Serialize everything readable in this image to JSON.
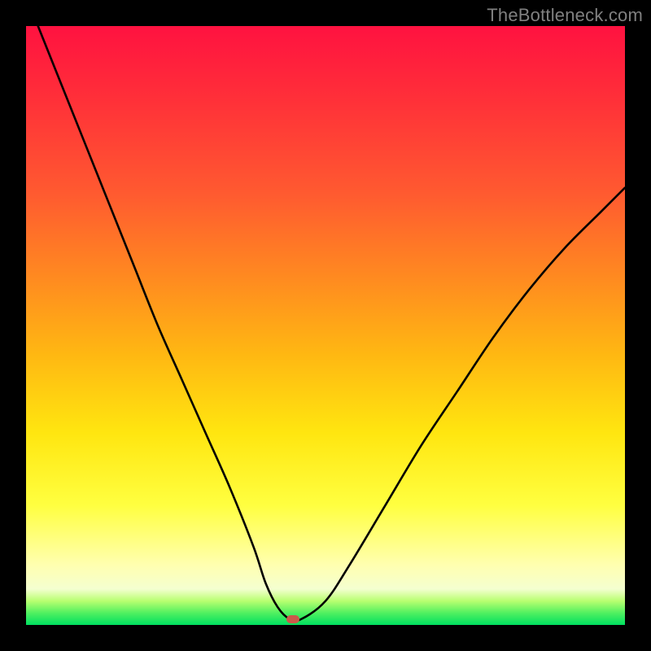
{
  "watermark": "TheBottleneck.com",
  "colors": {
    "frame": "#000000",
    "gradient_top": "#ff1240",
    "gradient_mid1": "#ff8a20",
    "gradient_mid2": "#ffe610",
    "gradient_bottom": "#00e060",
    "curve": "#000000",
    "marker": "#cc5a4a",
    "watermark_text": "#808080"
  },
  "chart_data": {
    "type": "line",
    "title": "",
    "xlabel": "",
    "ylabel": "",
    "xlim": [
      0,
      100
    ],
    "ylim": [
      0,
      100
    ],
    "x": [
      2,
      6,
      10,
      14,
      18,
      22,
      26,
      30,
      34,
      38,
      40,
      42,
      44,
      46,
      50,
      54,
      60,
      66,
      72,
      78,
      84,
      90,
      96,
      100
    ],
    "values": [
      100,
      90,
      80,
      70,
      60,
      50,
      41,
      32,
      23,
      13,
      7,
      3,
      1,
      1,
      4,
      10,
      20,
      30,
      39,
      48,
      56,
      63,
      69,
      73
    ],
    "marker": {
      "x_pct": 44.5,
      "y_pct": 1.0
    },
    "annotations": []
  }
}
